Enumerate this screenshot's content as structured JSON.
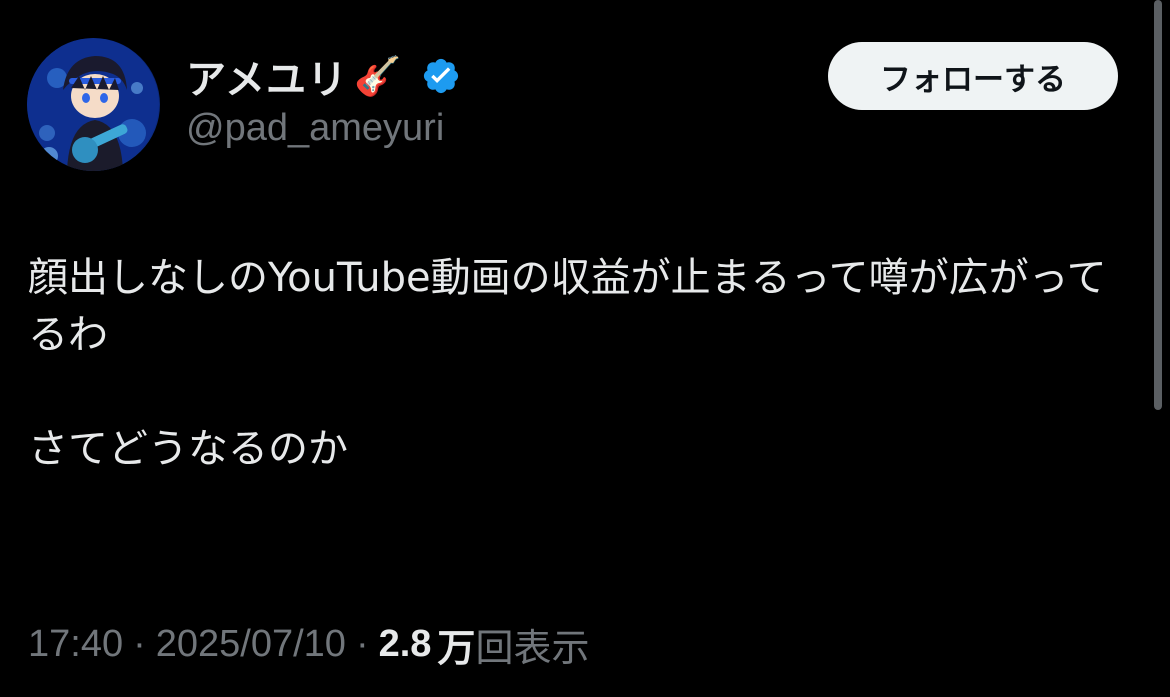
{
  "author": {
    "display_name": "アメユリ",
    "name_emoji": "🎸",
    "handle": "@pad_ameyuri",
    "verified": true,
    "verified_color": "#1d9bf0",
    "avatar_icon": "avatar-illustration"
  },
  "follow_button": {
    "label": "フォローする"
  },
  "tweet": {
    "text": "顔出しなしのYouTube動画の収益が止まるって噂が広がってるわ\n\nさてどうなるのか"
  },
  "meta": {
    "time": "17:40",
    "separator": "·",
    "date": "2025/07/10",
    "views_count": "2.8",
    "views_unit": "万",
    "views_label": "回表示"
  },
  "colors": {
    "background": "#000000",
    "primary_text": "#e7e9ea",
    "secondary_text": "#71767b",
    "button_bg": "#eff3f4",
    "button_text": "#0f1419"
  }
}
